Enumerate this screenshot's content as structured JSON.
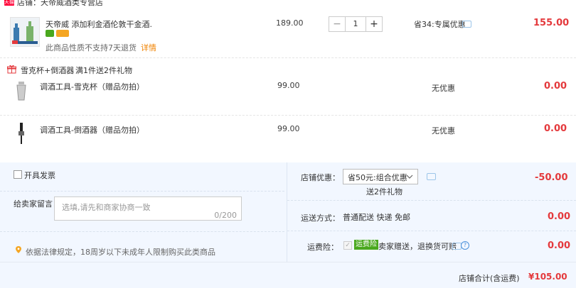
{
  "shop": {
    "badge": "天猫",
    "name": "店铺：天帝威酒类专营店"
  },
  "main_item": {
    "title": "天帝威 添加利金酒伦敦干金酒..",
    "notice": "此商品性质不支持7天退货",
    "detail_link": "详情",
    "price": "189.00",
    "quantity": "1",
    "discount": "省34:专属优惠",
    "subtotal": "155.00"
  },
  "promo": {
    "label": "雪克杯+倒酒器",
    "rule": "满1件送2件礼物"
  },
  "gifts": [
    {
      "name": "调酒工具-雪克杯（赠品勿拍）",
      "price": "99.00",
      "discount": "无优惠",
      "subtotal": "0.00"
    },
    {
      "name": "调酒工具-倒酒器（赠品勿拍）",
      "price": "99.00",
      "discount": "无优惠",
      "subtotal": "0.00"
    }
  ],
  "invoice": {
    "label": "开具发票"
  },
  "message": {
    "label": "给卖家留言：",
    "placeholder": "选填,请先和商家协商一致",
    "counter": "0/200"
  },
  "legal_notice": "依据法律规定，18周岁以下未成年人限制购买此类商品",
  "shop_discount": {
    "label": "店铺优惠：",
    "selected": "省50元:组合优惠",
    "note": "送2件礼物",
    "amount": "-50.00"
  },
  "shipping": {
    "label": "运送方式：",
    "value": "普通配送 快递 免邮",
    "amount": "0.00"
  },
  "insurance": {
    "label": "运费险：",
    "badge": "运费险",
    "text": "卖家赠送，退换货可赔",
    "amount": "0.00"
  },
  "total": {
    "label": "店铺合计(含运费)",
    "amount": "¥105.00"
  },
  "colors": {
    "accent_red": "#e4393c",
    "bottom_bg": "#f2f7ff",
    "insurance_green": "#4aa81e"
  }
}
